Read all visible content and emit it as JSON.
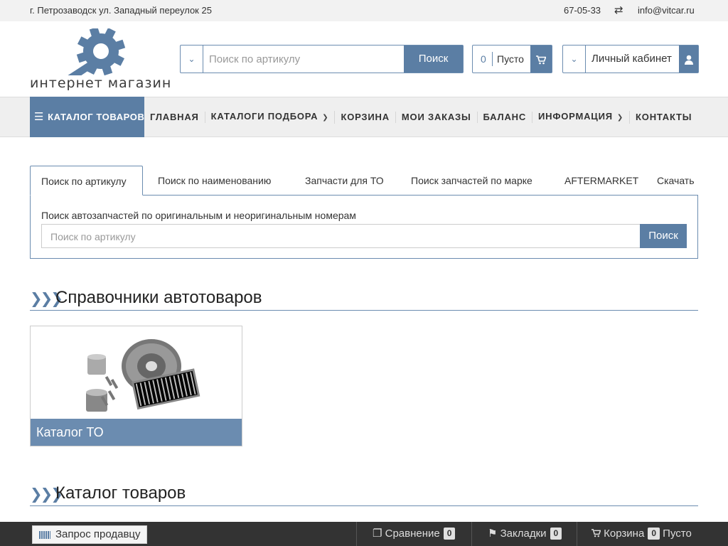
{
  "topbar": {
    "address": "г. Петрозаводск ул. Западный переулок 25",
    "phone": "67-05-33",
    "email": "info@vitcar.ru"
  },
  "logo": {
    "text": "интернет магазин",
    "color": "#5b7ea4"
  },
  "header_search": {
    "placeholder": "Поиск по артикулу",
    "button": "Поиск"
  },
  "cart": {
    "count": "0",
    "status": "Пусто"
  },
  "account": {
    "label": "Личный кабинет"
  },
  "nav": {
    "catalog": "КАТАЛОГ ТОВАРОВ",
    "items": [
      "ГЛАВНАЯ",
      "КАТАЛОГИ ПОДБОРА",
      "КОРЗИНА",
      "МОИ ЗАКАЗЫ",
      "БАЛАНС",
      "ИНФОРМАЦИЯ",
      "КОНТАКТЫ"
    ]
  },
  "tabs": {
    "items": [
      "Поиск по артикулу",
      "Поиск по наименованию",
      "Запчасти для ТО",
      "Поиск запчастей по марке",
      "AFTERMARKET",
      "Скачать"
    ],
    "active_index": 0
  },
  "search_panel": {
    "description": "Поиск автозапчастей по оригинальным и неоригинальным номерам",
    "placeholder": "Поиск по артикулу",
    "button": "Поиск"
  },
  "sections": {
    "references": "Справочники автотоваров",
    "catalog": "Каталог товаров"
  },
  "card": {
    "caption": "Каталог ТО"
  },
  "footer": {
    "request": "Запрос продавцу",
    "compare_label": "Сравнение",
    "compare_count": "0",
    "bookmarks_label": "Закладки",
    "bookmarks_count": "0",
    "cart_label": "Корзина",
    "cart_count": "0",
    "cart_status": "Пусто"
  },
  "colors": {
    "accent": "#5b7ea4",
    "footer_bg": "#333333",
    "nav_bg": "#efefef"
  }
}
